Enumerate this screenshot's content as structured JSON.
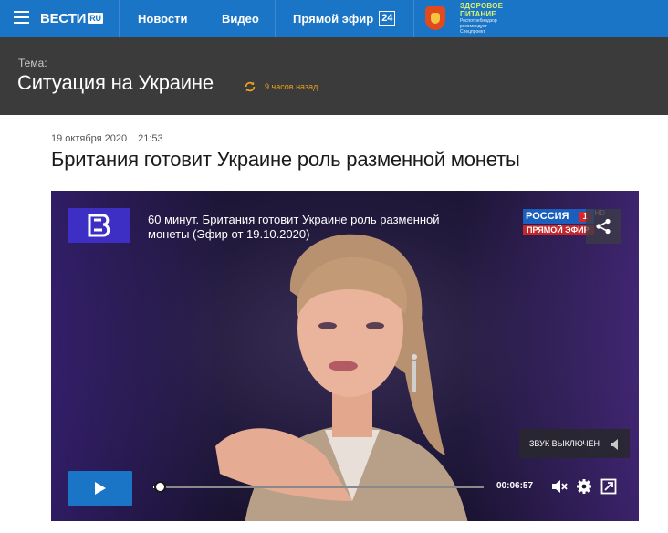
{
  "nav": {
    "logo_text": "ВЕСТИ",
    "logo_suffix": "RU",
    "links": [
      "Новости",
      "Видео",
      "Прямой эфир"
    ],
    "live_badge": "24",
    "partner": {
      "line1": "ЗДОРОВОЕ",
      "line2": "ПИТАНИЕ",
      "line3": "Роспотребнадзор",
      "line4": "рекомендует",
      "line5": "Спецпроект"
    },
    "brand_color": "#1a75c7"
  },
  "topic": {
    "label": "Тема:",
    "title": "Ситуация на Украине",
    "time_ago": "9 часов назад",
    "accent_color": "#f0a21c"
  },
  "article": {
    "date": "19 октября 2020",
    "time": "21:53",
    "headline": "Британия готовит Украине роль разменной монеты"
  },
  "video": {
    "title": "60 минут. Британия готовит Украине роль разменной монеты (Эфир от 19.10.2020)",
    "channel_name": "РОССИЯ",
    "channel_number": "1",
    "channel_hd": "HD",
    "channel_live": "ПРЯМОЙ ЭФИР",
    "mute_notice": "ЗВУК ВЫКЛЮЧЕН",
    "duration": "00:06:57",
    "progress_fraction": 0.02,
    "icons": [
      "share-icon",
      "play-icon",
      "mute-icon",
      "settings-icon",
      "fullscreen-icon"
    ]
  }
}
